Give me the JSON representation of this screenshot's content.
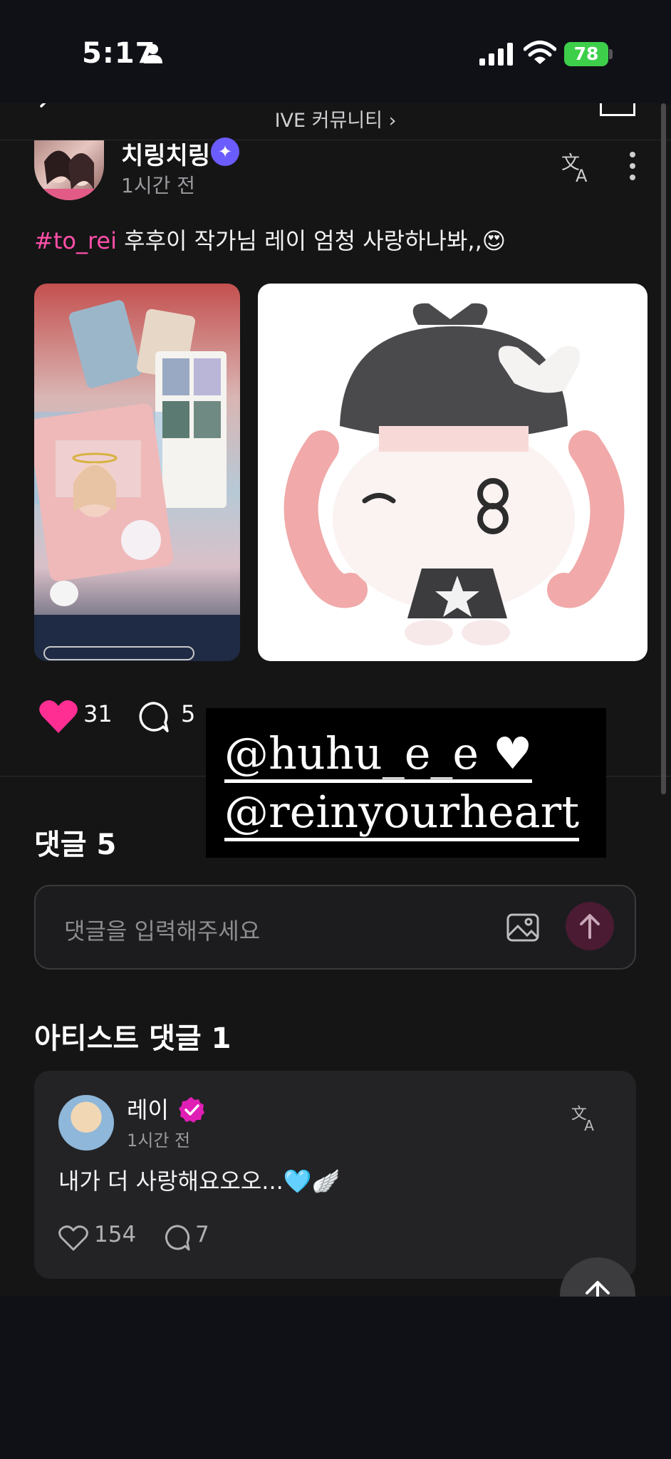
{
  "status_bar": {
    "time": "5:17",
    "battery": "78"
  },
  "nav": {
    "community": "IVE 커뮤니티 ›"
  },
  "post": {
    "author": "치링치링",
    "time": "1시간 전",
    "hashtag": "#to_rei",
    "text": " 후후이 작가님 레이 엄청 사랑하나봐,,😍",
    "likes": "31",
    "comments": "5"
  },
  "sticker": {
    "line1": "@huhu_e_e ♥",
    "line2": "@reinyourheart"
  },
  "comments": {
    "heading": "댓글 5",
    "input_placeholder": "댓글을 입력해주세요"
  },
  "artist_comments": {
    "heading": "아티스트 댓글 1",
    "items": [
      {
        "name": "레이",
        "time": "1시간 전",
        "text": "내가 더 사랑해요오오...🩵🪽",
        "likes": "154",
        "replies": "7"
      }
    ]
  },
  "colors": {
    "hashtag": "#ff4fa8",
    "heart": "#ff2e93",
    "verified": "#e01fb5",
    "sparkle_badge": "#6b5cff",
    "battery": "#3ecf4a",
    "send_button": "#4a1b32"
  },
  "icons": [
    "person-icon",
    "signal-icon",
    "wifi-icon",
    "back-icon",
    "square-icon",
    "sparkle-badge-icon",
    "translate-icon",
    "more-icon",
    "heart-filled-icon",
    "comment-icon",
    "image-upload-icon",
    "arrow-up-icon",
    "verified-icon",
    "heart-outline-icon",
    "reply-icon"
  ]
}
